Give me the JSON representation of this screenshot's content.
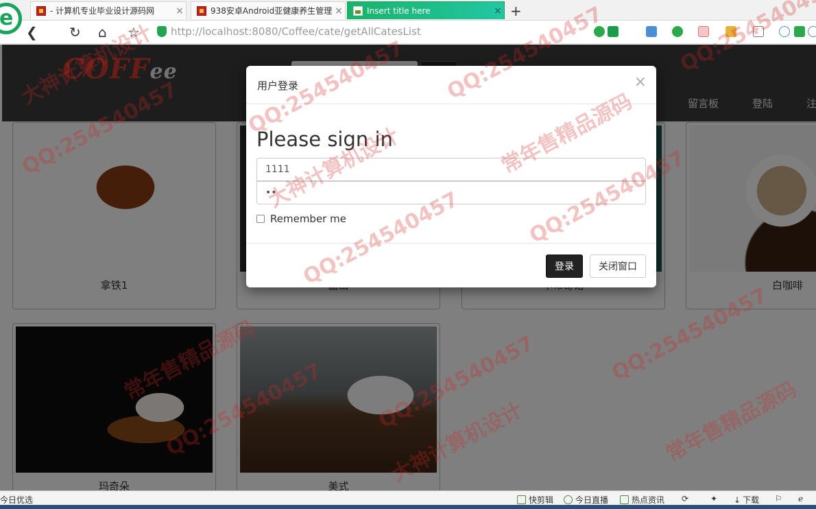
{
  "browser": {
    "logo_letter": "e",
    "tabs": [
      {
        "title": "- 计算机专业毕业设计源码网",
        "active": false
      },
      {
        "title": "938安卓Android亚健康养生管理",
        "active": false
      },
      {
        "title": "Insert title here",
        "active": true
      }
    ],
    "new_tab": "+",
    "url_host": "localhost",
    "url_rest": ":8080/Coffee/cate/getAllCatesList",
    "url_scheme": "http://"
  },
  "site": {
    "logo": "COFF",
    "logo_tail": "ee",
    "nav": [
      "留言板",
      "登陆",
      "注"
    ]
  },
  "products": [
    {
      "name": "拿铁1",
      "img": "latte"
    },
    {
      "name": "蓝山",
      "img": "bing"
    },
    {
      "name": "卡布奇诺",
      "img": "mocha"
    },
    {
      "name": "白咖啡",
      "img": "white"
    },
    {
      "name": "玛奇朵",
      "img": "macchiato"
    },
    {
      "name": "美式",
      "img": "americano"
    }
  ],
  "modal": {
    "title": "用户登录",
    "close": "×",
    "heading": "Please sign in",
    "username_value": "1111",
    "password_value": "••",
    "remember_label": "Remember me",
    "login_button": "登录",
    "close_button": "关闭窗口"
  },
  "statusbar": {
    "left": "今日优选",
    "items": [
      "快剪辑",
      "今日直播",
      "热点资讯",
      "下载"
    ]
  },
  "watermarks": [
    "QQ:254540457",
    "常年售精品源码",
    "大神计算机设计"
  ],
  "colors": {
    "tab_active": "#1ab36b",
    "header_bg": "#3a3a3a",
    "logo_red": "#d23a2d",
    "login_btn": "#222222",
    "watermark": "#d22828"
  }
}
